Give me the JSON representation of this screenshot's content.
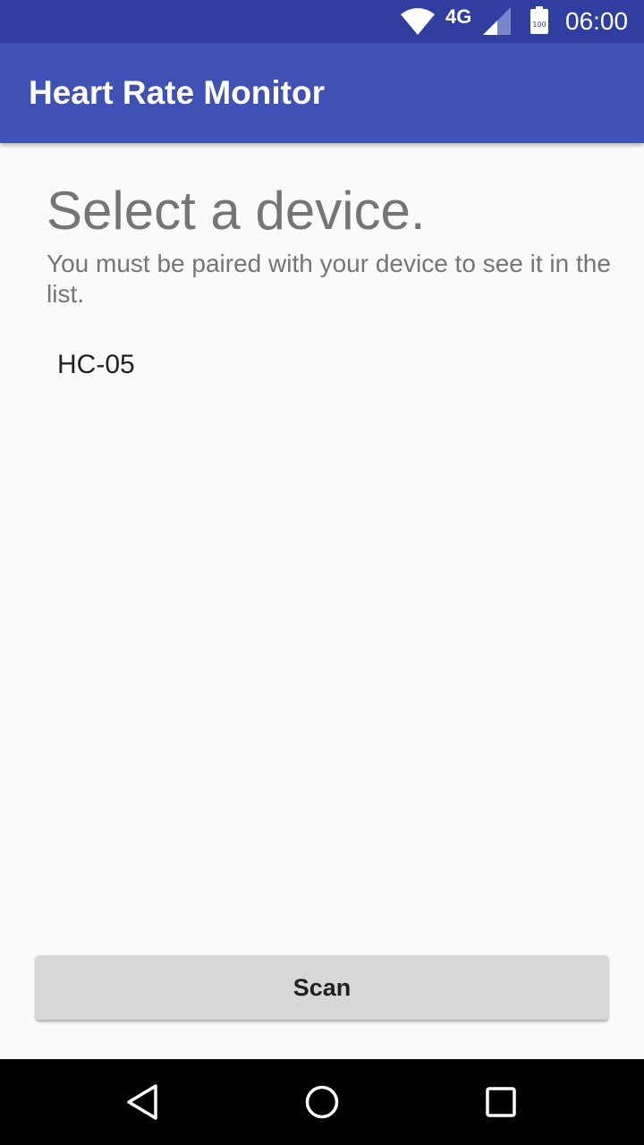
{
  "status_bar": {
    "network_type": "4G",
    "battery_level": "100",
    "time": "06:00",
    "icons": [
      "wifi-icon",
      "cell-signal-icon",
      "battery-icon"
    ]
  },
  "app_bar": {
    "title": "Heart Rate Monitor",
    "color": "#3f51b5",
    "status_color": "#303f9f"
  },
  "main": {
    "heading": "Select a device.",
    "subtext": "You must be paired with your device to see it in the list.",
    "devices": [
      {
        "name": "HC-05"
      }
    ]
  },
  "actions": {
    "scan_label": "Scan"
  },
  "nav_bar": {
    "icons": [
      "back-icon",
      "home-icon",
      "recents-icon"
    ]
  }
}
